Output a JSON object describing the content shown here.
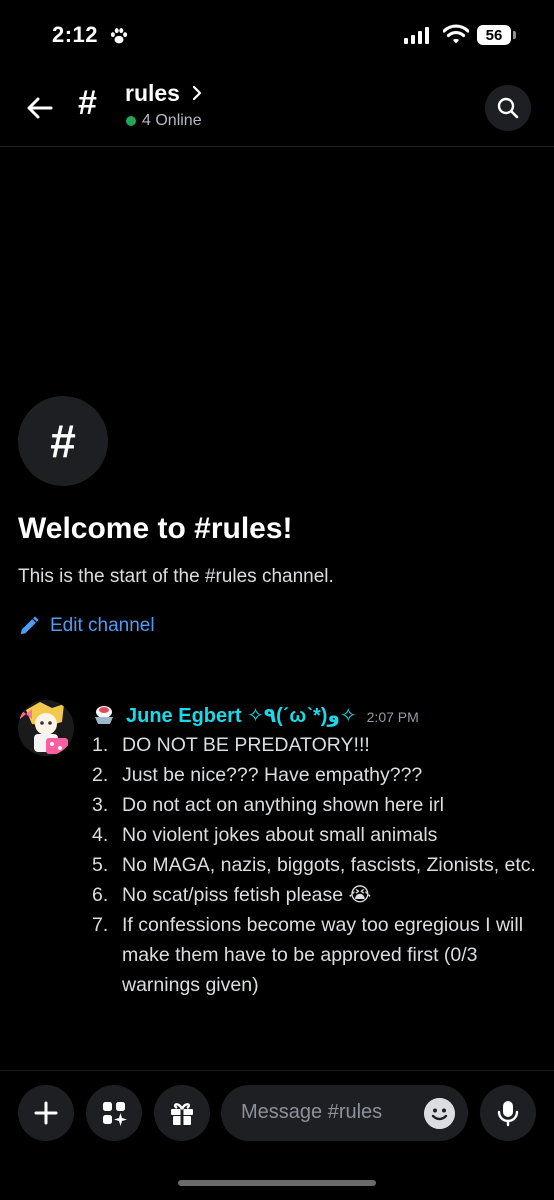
{
  "status_bar": {
    "time": "2:12",
    "battery": "56"
  },
  "header": {
    "channel": "rules",
    "online": "4 Online"
  },
  "welcome": {
    "title": "Welcome to #rules!",
    "subtitle": "This is the start of the #rules channel.",
    "edit_label": "Edit channel"
  },
  "message": {
    "author": "June Egbert ✧٩(ˊωˋ*)و✧",
    "timestamp": "2:07 PM",
    "rules": [
      {
        "num": "1.",
        "text": "DO NOT BE PREDATORY!!!"
      },
      {
        "num": "2.",
        "text": "Just be nice??? Have empathy???"
      },
      {
        "num": "3.",
        "text": "Do not act on anything shown here irl"
      },
      {
        "num": "4.",
        "text": "No violent jokes about small animals"
      },
      {
        "num": "5.",
        "text": "No MAGA, nazis, biggots, fascists, Zionists, etc."
      },
      {
        "num": "6.",
        "text": "No scat/piss fetish please 😭"
      },
      {
        "num": "7.",
        "text": "If confessions become way too egregious I will make them have to be approved first (0/3 warnings given)"
      }
    ]
  },
  "composer": {
    "placeholder": "Message #rules"
  },
  "colors": {
    "accent_link": "#4f9cf5",
    "author": "#1ad9e9",
    "online": "#23a55a",
    "background": "#000000"
  }
}
